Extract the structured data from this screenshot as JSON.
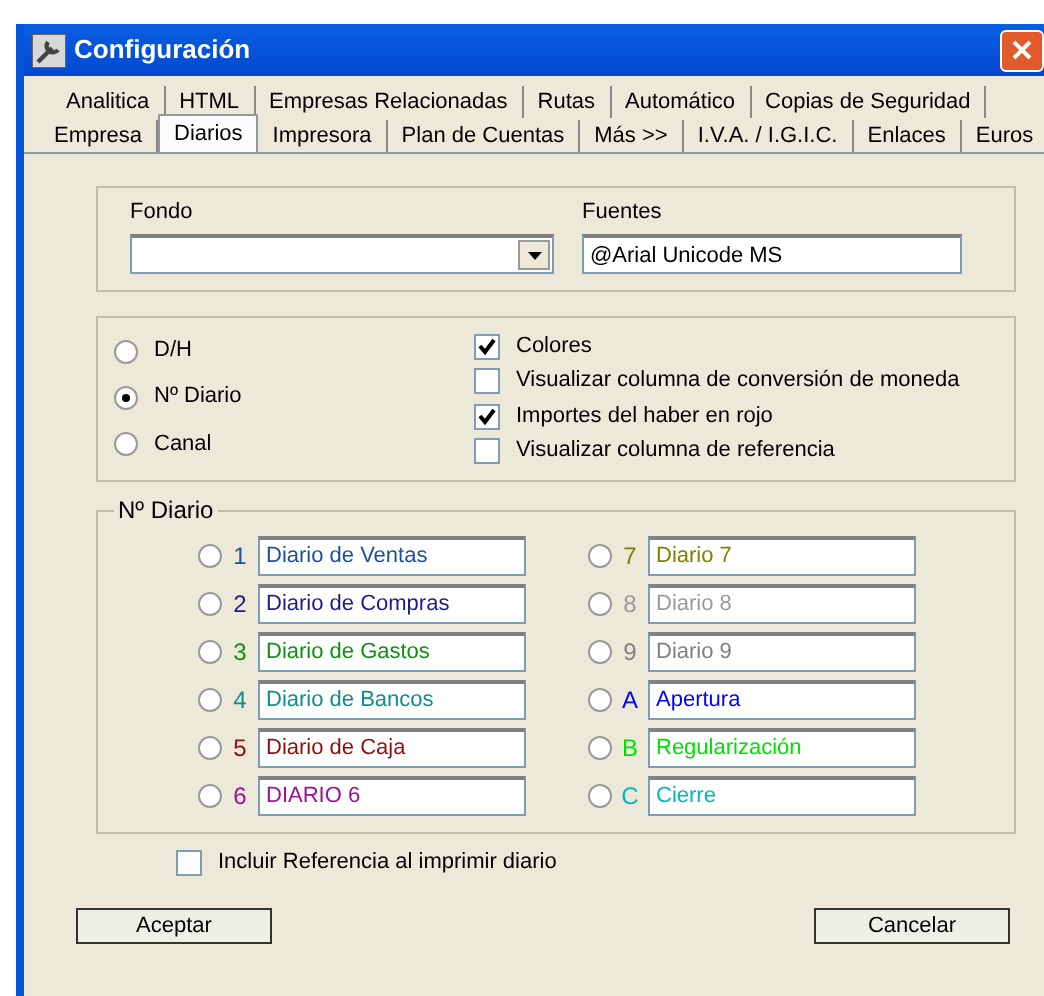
{
  "window": {
    "title": "Configuración"
  },
  "tab_rows": [
    [
      {
        "label": "Analitica",
        "selected": false
      },
      {
        "label": "HTML",
        "selected": false
      },
      {
        "label": "Empresas Relacionadas",
        "selected": false
      },
      {
        "label": "Rutas",
        "selected": false
      },
      {
        "label": "Automático",
        "selected": false
      },
      {
        "label": "Copias de Seguridad",
        "selected": false
      }
    ],
    [
      {
        "label": "Empresa",
        "selected": false
      },
      {
        "label": "Diarios",
        "selected": true
      },
      {
        "label": "Impresora",
        "selected": false
      },
      {
        "label": "Plan de Cuentas",
        "selected": false
      },
      {
        "label": "Más >>",
        "selected": false
      },
      {
        "label": "I.V.A. / I.G.I.C.",
        "selected": false
      },
      {
        "label": "Enlaces",
        "selected": false
      },
      {
        "label": "Euros",
        "selected": false
      }
    ]
  ],
  "fondo": {
    "label": "Fondo"
  },
  "fuentes": {
    "label": "Fuentes",
    "value": "@Arial Unicode MS"
  },
  "mode_options": [
    {
      "label": "D/H",
      "selected": false
    },
    {
      "label": "Nº Diario",
      "selected": true
    },
    {
      "label": "Canal",
      "selected": false
    }
  ],
  "checks": [
    {
      "label": "Colores",
      "checked": true
    },
    {
      "label": "Visualizar columna de conversión de moneda",
      "checked": false
    },
    {
      "label": "Importes del haber en rojo",
      "checked": true
    },
    {
      "label": "Visualizar columna de referencia",
      "checked": false
    }
  ],
  "diarios": {
    "title": "Nº Diario",
    "items": [
      {
        "key": "1",
        "name": "Diario de Ventas",
        "color": "#1c4f9c",
        "selected": false
      },
      {
        "key": "2",
        "name": "Diario de Compras",
        "color": "#1c1c8c",
        "selected": false
      },
      {
        "key": "3",
        "name": "Diario de Gastos",
        "color": "#109010",
        "selected": false
      },
      {
        "key": "4",
        "name": "Diario de Bancos",
        "color": "#108c8c",
        "selected": false
      },
      {
        "key": "5",
        "name": "Diario de Caja",
        "color": "#8c1010",
        "selected": false
      },
      {
        "key": "6",
        "name": "DIARIO 6",
        "color": "#9c109c",
        "selected": false
      },
      {
        "key": "7",
        "name": "Diario 7",
        "color": "#808000",
        "selected": false
      },
      {
        "key": "8",
        "name": "Diario 8",
        "color": "#9a9a9a",
        "selected": false
      },
      {
        "key": "9",
        "name": "Diario 9",
        "color": "#808080",
        "selected": false
      },
      {
        "key": "A",
        "name": "Apertura",
        "color": "#0000ff",
        "selected": false
      },
      {
        "key": "B",
        "name": "Regularización",
        "color": "#00e000",
        "selected": false
      },
      {
        "key": "C",
        "name": "Cierre",
        "color": "#00b4c4",
        "selected": false
      }
    ]
  },
  "incluir": {
    "label": "Incluir Referencia al imprimir diario",
    "checked": false
  },
  "buttons": [
    {
      "label": "Aceptar"
    },
    {
      "label": "Cancelar"
    }
  ]
}
